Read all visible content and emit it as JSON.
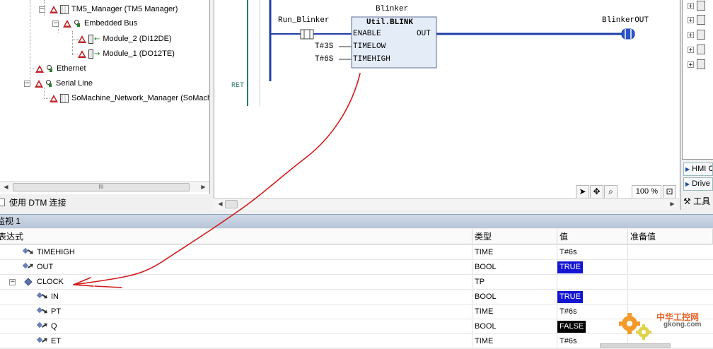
{
  "device_tree": {
    "items": [
      {
        "label": "TM5_Manager (TM5 Manager)"
      },
      {
        "label": "Embedded Bus"
      },
      {
        "label": "Module_2 (DI12DE)"
      },
      {
        "label": "Module_1 (DO12TE)"
      },
      {
        "label": "Ethernet"
      },
      {
        "label": "Serial Line"
      },
      {
        "label": "SoMachine_Network_Manager (SoMach"
      }
    ],
    "scroll_thumb_grip": "III"
  },
  "dtm_checkbox_label": "使用 DTM 连接",
  "ladder": {
    "fb_instance": "Blinker",
    "fb_type": "Util.BLINK",
    "inputs": [
      "ENABLE",
      "TIMELOW",
      "TIMEHIGH"
    ],
    "output": "OUT",
    "enable_contact": "Run_Blinker",
    "timelow_value": "T#3S",
    "timehigh_value": "T#6S",
    "output_coil": "BlinkerOUT",
    "ret_label": "RET",
    "zoom": "100 %"
  },
  "right_panel": {
    "tabs": [
      "HMI C",
      "Drive"
    ],
    "toolbox_label": "工具"
  },
  "watch": {
    "title": "监视 1",
    "columns": [
      "表达式",
      "类型",
      "值",
      "准备值"
    ],
    "rows": [
      {
        "expr": "TIMEHIGH",
        "type": "TIME",
        "value": "T#6s",
        "value_style": "plain"
      },
      {
        "expr": "OUT",
        "type": "BOOL",
        "value": "TRUE",
        "value_style": "true"
      },
      {
        "expr": "CLOCK",
        "type": "TP",
        "value": "",
        "value_style": "plain"
      },
      {
        "expr": "IN",
        "type": "BOOL",
        "value": "TRUE",
        "value_style": "true"
      },
      {
        "expr": "PT",
        "type": "TIME",
        "value": "T#6s",
        "value_style": "plain"
      },
      {
        "expr": "Q",
        "type": "BOOL",
        "value": "FALSE",
        "value_style": "false"
      },
      {
        "expr": "ET",
        "type": "TIME",
        "value": "T#6s",
        "value_style": "plain"
      }
    ]
  },
  "watermark": {
    "site_cn": "中华工控网",
    "site_en": "gkong.com"
  },
  "colors": {
    "true_bg": "#1414d2",
    "false_bg": "#000000",
    "annotation": "#d11a1a",
    "ladder_blue": "#1f3fa8",
    "rail_teal": "#2a7a6a"
  }
}
